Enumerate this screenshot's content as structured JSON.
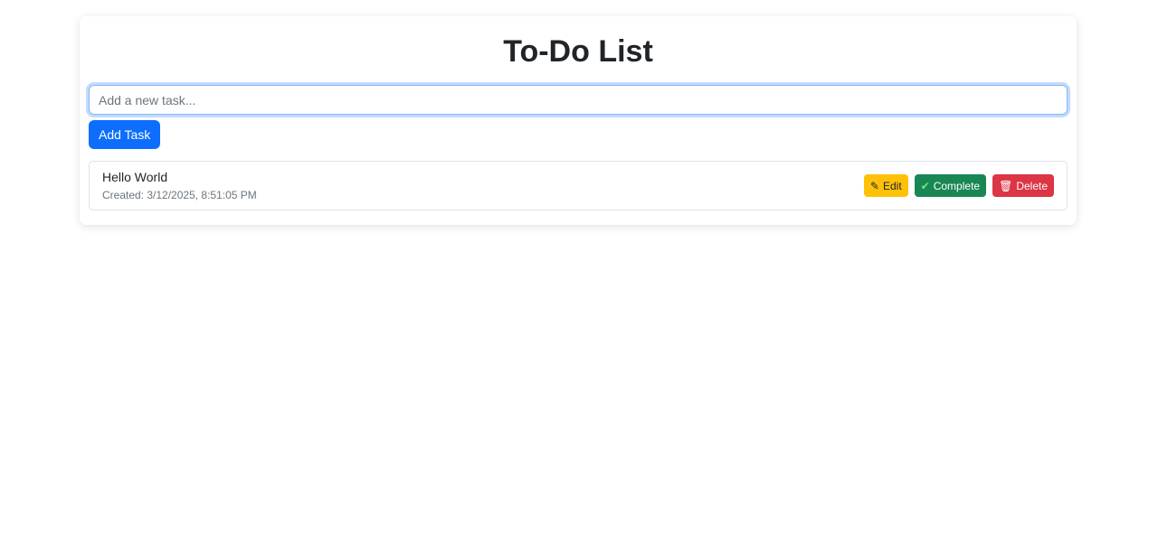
{
  "title": "To-Do List",
  "input": {
    "placeholder": "Add a new task...",
    "value": ""
  },
  "add_label": "Add Task",
  "tasks": [
    {
      "title": "Hello World",
      "created": "Created: 3/12/2025, 8:51:05 PM",
      "edit": "Edit",
      "complete": "Complete",
      "delete": "Delete"
    }
  ],
  "icons": {
    "edit": "pencil-icon",
    "complete": "check-icon",
    "delete": "trash-icon"
  }
}
